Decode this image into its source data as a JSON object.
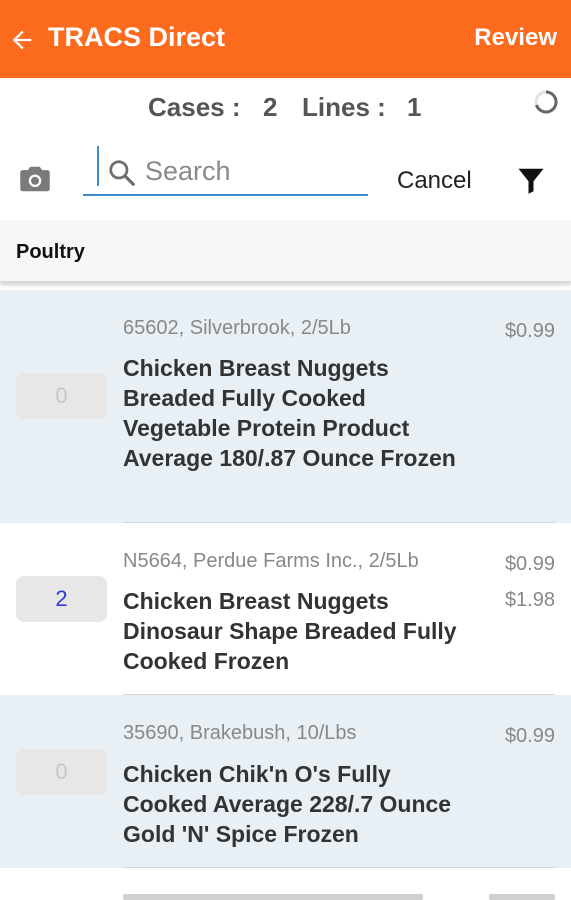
{
  "header": {
    "title": "TRACS Direct",
    "review_label": "Review",
    "bg_color": "#fb6a1d"
  },
  "summary": {
    "cases_label": "Cases :",
    "cases_value": "2",
    "lines_label": "Lines :",
    "lines_value": "1"
  },
  "search": {
    "placeholder": "Search",
    "cancel_label": "Cancel"
  },
  "category": {
    "name": "Poultry"
  },
  "items": [
    {
      "qty": "0",
      "meta": "65602, Silverbrook, 2/5Lb",
      "desc": "Chicken Breast Nuggets Breaded  Fully Cooked Vegetable Protein Product Average 180/.87 Ounce Frozen",
      "price": "$0.99",
      "total": ""
    },
    {
      "qty": "2",
      "meta": "N5664, Perdue Farms Inc., 2/5Lb",
      "desc": "Chicken Breast Nuggets Dinosaur Shape Breaded Fully Cooked Frozen",
      "price": "$0.99",
      "total": "$1.98"
    },
    {
      "qty": "0",
      "meta": "35690, Brakebush, 10/Lbs",
      "desc": "Chicken Chik'n O's Fully Cooked Average 228/.7 Ounce Gold 'N' Spice Frozen",
      "price": "$0.99",
      "total": ""
    }
  ],
  "icons": {
    "back": "arrow-left-icon",
    "spinner": "loading-spinner-icon",
    "camera": "camera-icon",
    "search": "search-icon",
    "filter": "filter-icon"
  }
}
